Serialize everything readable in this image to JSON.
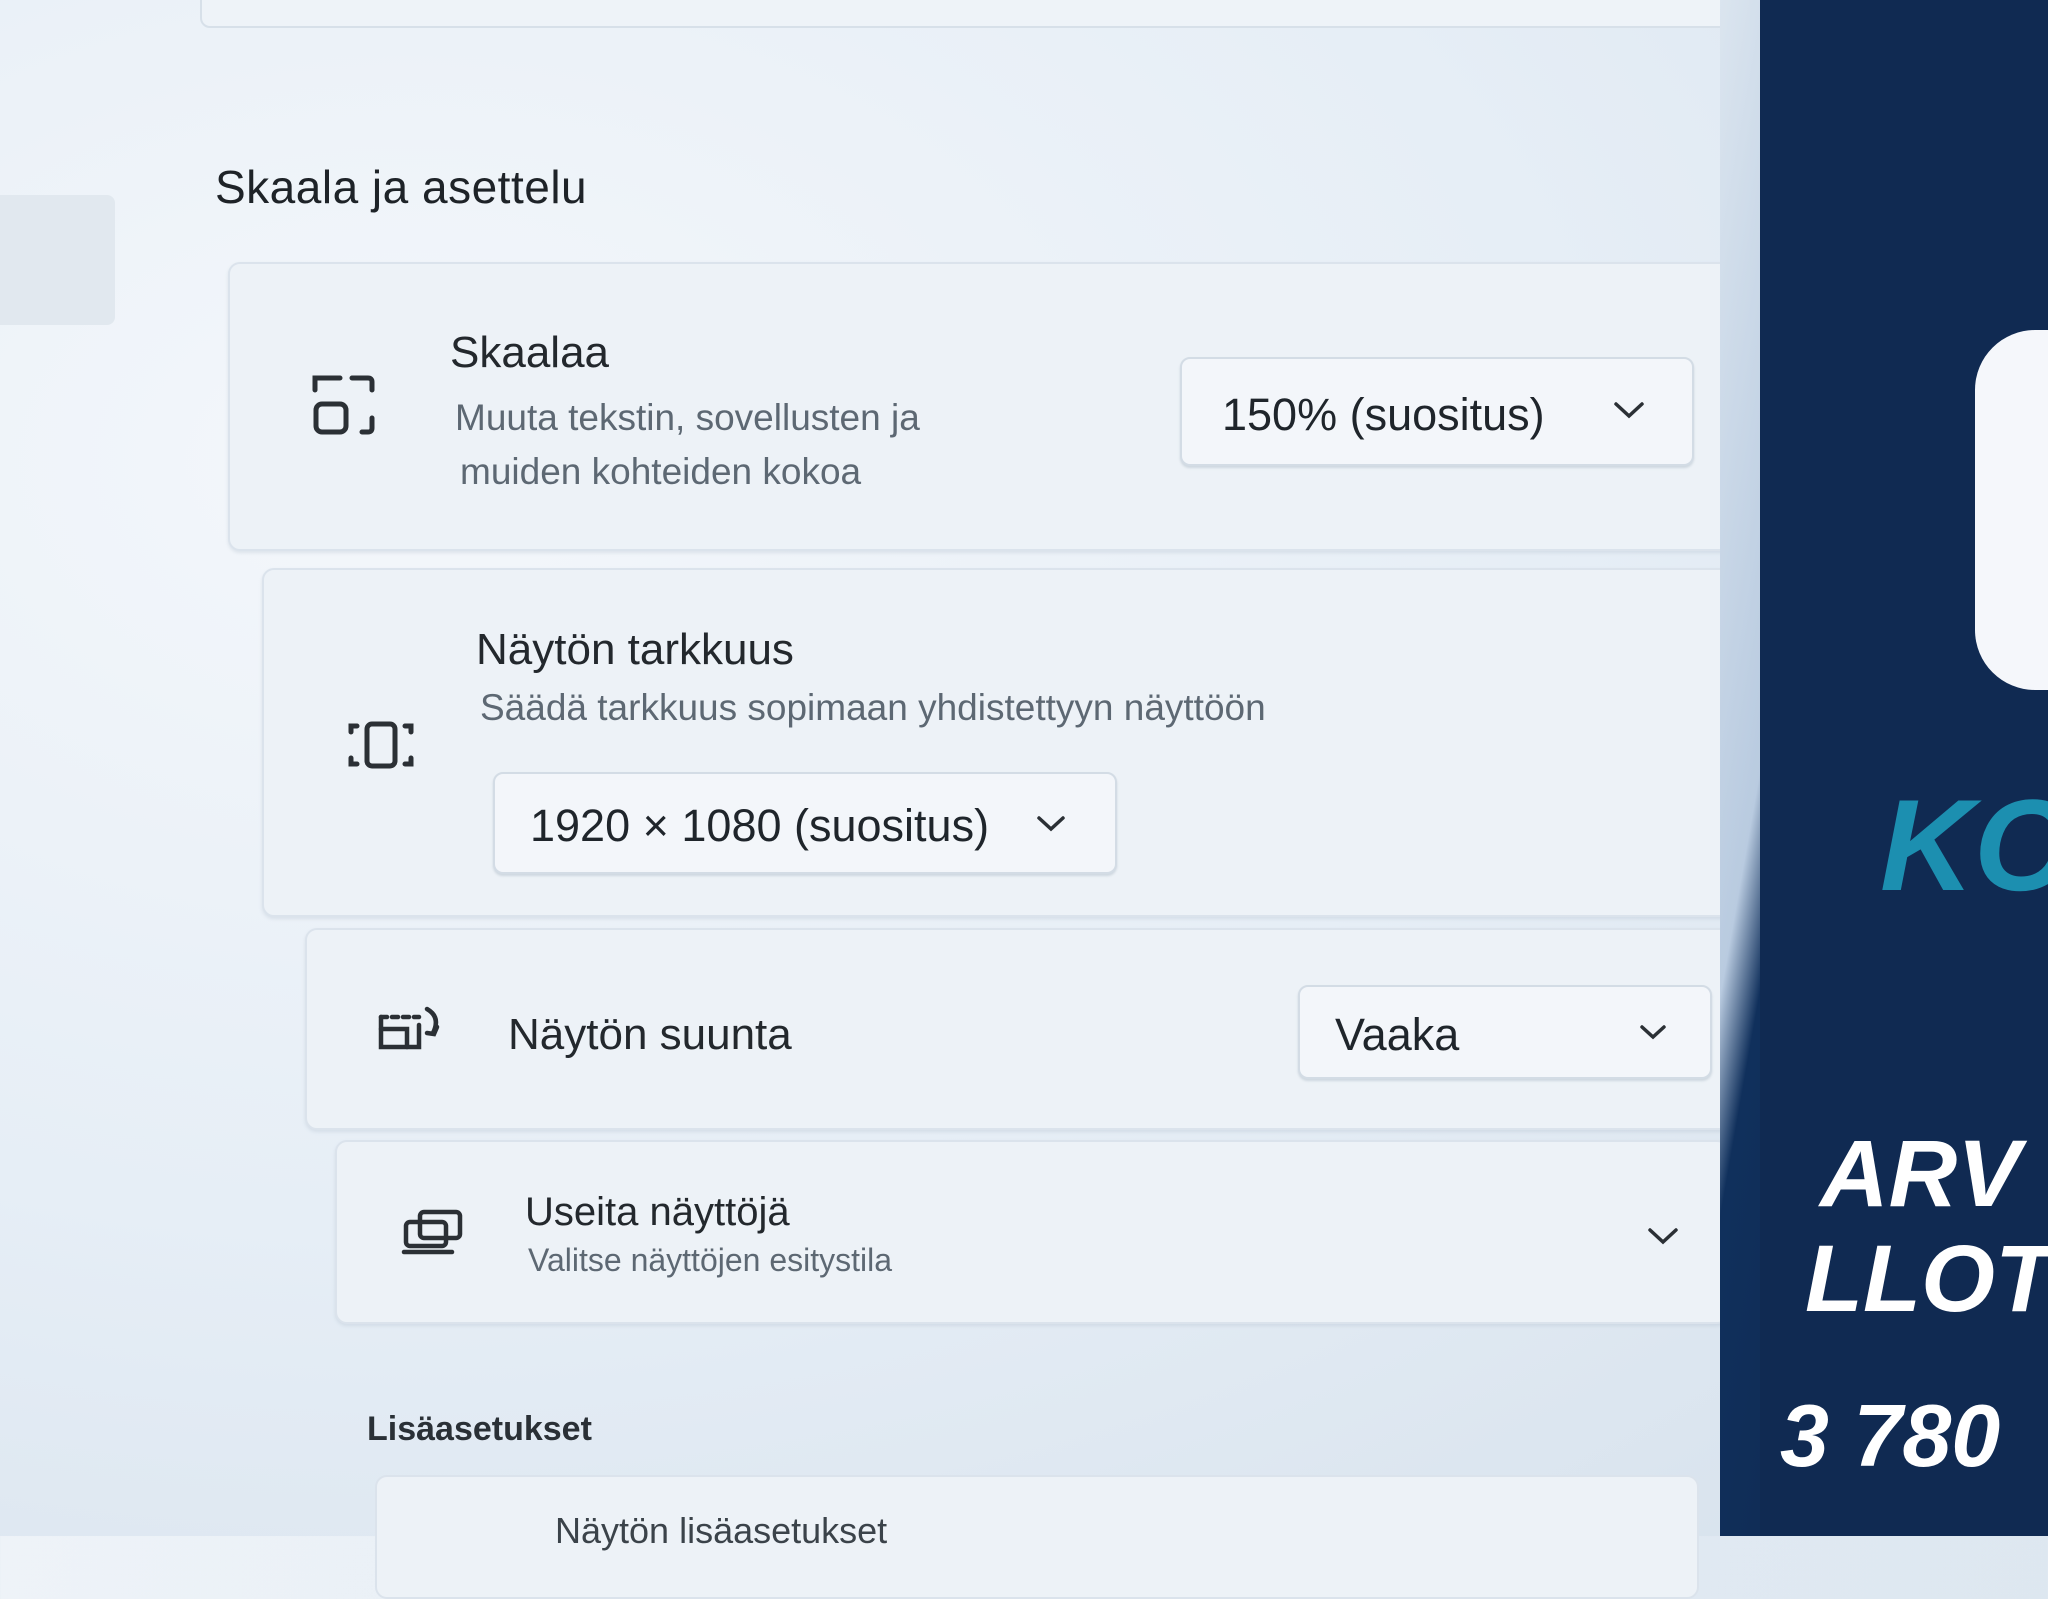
{
  "section_title": "Skaala ja asettelu",
  "scale": {
    "title": "Skaalaa",
    "description_line1": "Muuta tekstin, sovellusten ja",
    "description_line2": "muiden kohteiden kokoa",
    "value": "150% (suositus)"
  },
  "resolution": {
    "title": "Näytön tarkkuus",
    "description": "Säädä tarkkuus sopimaan yhdistettyyn näyttöön",
    "value": "1920 × 1080 (suositus)"
  },
  "orientation": {
    "title": "Näytön suunta",
    "value": "Vaaka"
  },
  "multiple_displays": {
    "title": "Useita näyttöjä",
    "description": "Valitse näyttöjen esitystila"
  },
  "advanced": {
    "heading": "Lisäasetukset",
    "item_label": "Näytön lisäasetukset"
  },
  "poster": {
    "line1": "KO",
    "line2": "ARV",
    "line3": "LLOT",
    "line4": "3 780"
  },
  "colors": {
    "poster_bg": "#102a52",
    "poster_accent": "#1c8fb0",
    "poster_text": "#ffffff"
  }
}
